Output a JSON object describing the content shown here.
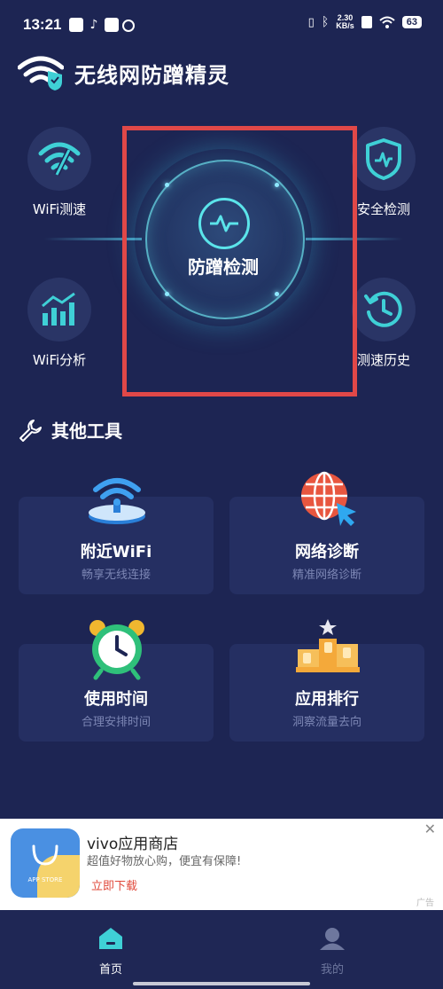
{
  "status_bar": {
    "time": "13:21",
    "net_speed_value": "2.30",
    "net_speed_unit": "KB/s",
    "battery": "63"
  },
  "header": {
    "title": "无线网防蹭精灵"
  },
  "features": {
    "wifi_speed": "WiFi测速",
    "security_check": "安全检测",
    "main_button": "防蹭检测",
    "wifi_analysis": "WiFi分析",
    "speed_history": "测速历史"
  },
  "tools": {
    "section_title": "其他工具",
    "items": [
      {
        "title": "附近WiFi",
        "subtitle": "畅享无线连接"
      },
      {
        "title": "网络诊断",
        "subtitle": "精准网络诊断"
      },
      {
        "title": "使用时间",
        "subtitle": "合理安排时间"
      },
      {
        "title": "应用排行",
        "subtitle": "洞察流量去向"
      }
    ]
  },
  "ad": {
    "title": "vivo应用商店",
    "subtitle": "超值好物放心购，便宜有保障!",
    "cta": "立即下载",
    "logo_text": "APP STORE",
    "close": "✕",
    "tag": "广告"
  },
  "nav": {
    "home": "首页",
    "mine": "我的"
  },
  "colors": {
    "background": "#1d2553",
    "accent": "#5be4ea",
    "highlight": "#e04848"
  }
}
